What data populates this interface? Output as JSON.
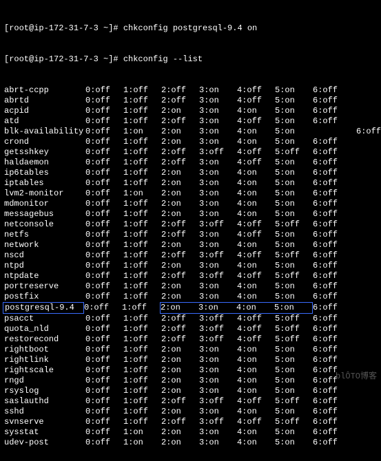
{
  "prompt_prefix": "[root@ip-172-31-7-3 ~]# ",
  "cmd1": "chkconfig postgresql-9.4 on",
  "cmd2": "chkconfig --list",
  "watermark": "blÔTO博客",
  "highlight": "postgresql-9.4",
  "chart_data": {
    "type": "table",
    "title": "chkconfig --list",
    "levels": [
      "0",
      "1",
      "2",
      "3",
      "4",
      "5",
      "6"
    ],
    "extra": {
      "blk-availability": {
        "6": "off"
      }
    },
    "services": [
      {
        "name": "abrt-ccpp",
        "v": [
          "off",
          "off",
          "off",
          "on",
          "off",
          "on",
          "off"
        ]
      },
      {
        "name": "abrtd",
        "v": [
          "off",
          "off",
          "off",
          "on",
          "off",
          "on",
          "off"
        ]
      },
      {
        "name": "acpid",
        "v": [
          "off",
          "off",
          "on",
          "on",
          "on",
          "on",
          "off"
        ]
      },
      {
        "name": "atd",
        "v": [
          "off",
          "off",
          "off",
          "on",
          "off",
          "on",
          "off"
        ]
      },
      {
        "name": "blk-availability",
        "v": [
          "off",
          "on",
          "on",
          "on",
          "on",
          "on",
          ""
        ]
      },
      {
        "name": "crond",
        "v": [
          "off",
          "off",
          "on",
          "on",
          "on",
          "on",
          "off"
        ]
      },
      {
        "name": "getsshkey",
        "v": [
          "off",
          "off",
          "off",
          "off",
          "off",
          "off",
          "off"
        ]
      },
      {
        "name": "haldaemon",
        "v": [
          "off",
          "off",
          "off",
          "on",
          "off",
          "on",
          "off"
        ]
      },
      {
        "name": "ip6tables",
        "v": [
          "off",
          "off",
          "on",
          "on",
          "on",
          "on",
          "off"
        ]
      },
      {
        "name": "iptables",
        "v": [
          "off",
          "off",
          "on",
          "on",
          "on",
          "on",
          "off"
        ]
      },
      {
        "name": "lvm2-monitor",
        "v": [
          "off",
          "on",
          "on",
          "on",
          "on",
          "on",
          "off"
        ]
      },
      {
        "name": "mdmonitor",
        "v": [
          "off",
          "off",
          "on",
          "on",
          "on",
          "on",
          "off"
        ]
      },
      {
        "name": "messagebus",
        "v": [
          "off",
          "off",
          "on",
          "on",
          "on",
          "on",
          "off"
        ]
      },
      {
        "name": "netconsole",
        "v": [
          "off",
          "off",
          "off",
          "off",
          "off",
          "off",
          "off"
        ]
      },
      {
        "name": "netfs",
        "v": [
          "off",
          "off",
          "off",
          "on",
          "off",
          "on",
          "off"
        ]
      },
      {
        "name": "network",
        "v": [
          "off",
          "off",
          "on",
          "on",
          "on",
          "on",
          "off"
        ]
      },
      {
        "name": "nscd",
        "v": [
          "off",
          "off",
          "off",
          "off",
          "off",
          "off",
          "off"
        ]
      },
      {
        "name": "ntpd",
        "v": [
          "off",
          "off",
          "on",
          "on",
          "on",
          "on",
          "off"
        ]
      },
      {
        "name": "ntpdate",
        "v": [
          "off",
          "off",
          "off",
          "off",
          "off",
          "off",
          "off"
        ]
      },
      {
        "name": "portreserve",
        "v": [
          "off",
          "off",
          "on",
          "on",
          "on",
          "on",
          "off"
        ]
      },
      {
        "name": "postfix",
        "v": [
          "off",
          "off",
          "on",
          "on",
          "on",
          "on",
          "off"
        ]
      },
      {
        "name": "postgresql-9.4",
        "v": [
          "off",
          "off",
          "on",
          "on",
          "on",
          "on",
          "off"
        ]
      },
      {
        "name": "psacct",
        "v": [
          "off",
          "off",
          "off",
          "off",
          "off",
          "off",
          "off"
        ]
      },
      {
        "name": "quota_nld",
        "v": [
          "off",
          "off",
          "off",
          "off",
          "off",
          "off",
          "off"
        ]
      },
      {
        "name": "restorecond",
        "v": [
          "off",
          "off",
          "off",
          "off",
          "off",
          "off",
          "off"
        ]
      },
      {
        "name": "rightboot",
        "v": [
          "off",
          "off",
          "on",
          "on",
          "on",
          "on",
          "off"
        ]
      },
      {
        "name": "rightlink",
        "v": [
          "off",
          "off",
          "on",
          "on",
          "on",
          "on",
          "off"
        ]
      },
      {
        "name": "rightscale",
        "v": [
          "off",
          "off",
          "on",
          "on",
          "on",
          "on",
          "off"
        ]
      },
      {
        "name": "rngd",
        "v": [
          "off",
          "off",
          "on",
          "on",
          "on",
          "on",
          "off"
        ]
      },
      {
        "name": "rsyslog",
        "v": [
          "off",
          "off",
          "on",
          "on",
          "on",
          "on",
          "off"
        ]
      },
      {
        "name": "saslauthd",
        "v": [
          "off",
          "off",
          "off",
          "off",
          "off",
          "off",
          "off"
        ]
      },
      {
        "name": "sshd",
        "v": [
          "off",
          "off",
          "on",
          "on",
          "on",
          "on",
          "off"
        ]
      },
      {
        "name": "svnserve",
        "v": [
          "off",
          "off",
          "off",
          "off",
          "off",
          "off",
          "off"
        ]
      },
      {
        "name": "sysstat",
        "v": [
          "off",
          "on",
          "on",
          "on",
          "on",
          "on",
          "off"
        ]
      },
      {
        "name": "udev-post",
        "v": [
          "off",
          "on",
          "on",
          "on",
          "on",
          "on",
          "off"
        ]
      }
    ]
  }
}
